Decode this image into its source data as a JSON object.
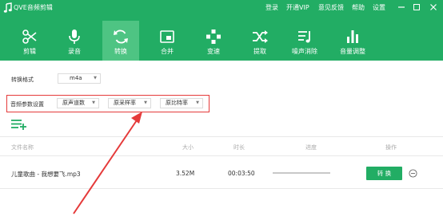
{
  "app": {
    "title": "QVE音频剪辑"
  },
  "menu": {
    "login": "登录",
    "vip": "开通VIP",
    "feedback": "意见反馈",
    "help": "帮助",
    "settings": "设置"
  },
  "toolbar": [
    {
      "label": "剪辑",
      "icon": "scissors-icon"
    },
    {
      "label": "录音",
      "icon": "microphone-icon"
    },
    {
      "label": "转换",
      "icon": "convert-icon",
      "active": true
    },
    {
      "label": "合并",
      "icon": "merge-icon"
    },
    {
      "label": "变速",
      "icon": "speed-icon"
    },
    {
      "label": "提取",
      "icon": "extract-icon"
    },
    {
      "label": "噪声消除",
      "icon": "noise-reduction-icon"
    },
    {
      "label": "音量调整",
      "icon": "volume-icon"
    }
  ],
  "format": {
    "label": "转换格式",
    "value": "m4a"
  },
  "audio_params": {
    "label": "音频参数设置",
    "channels": "原声道数",
    "sample_rate": "原采样率",
    "bitrate": "原比特率"
  },
  "table": {
    "headers": {
      "name": "文件名称",
      "size": "大小",
      "duration": "时长",
      "progress": "进度",
      "action": "操作"
    },
    "rows": [
      {
        "name": "儿童歌曲 - 我想要飞.mp3",
        "size": "3.52M",
        "duration": "00:03:50",
        "progress": 0,
        "action": "转 换"
      }
    ]
  },
  "colors": {
    "brand": "#22ad64",
    "active_tab": "#4ec483",
    "annotation": "#e53a3a"
  }
}
